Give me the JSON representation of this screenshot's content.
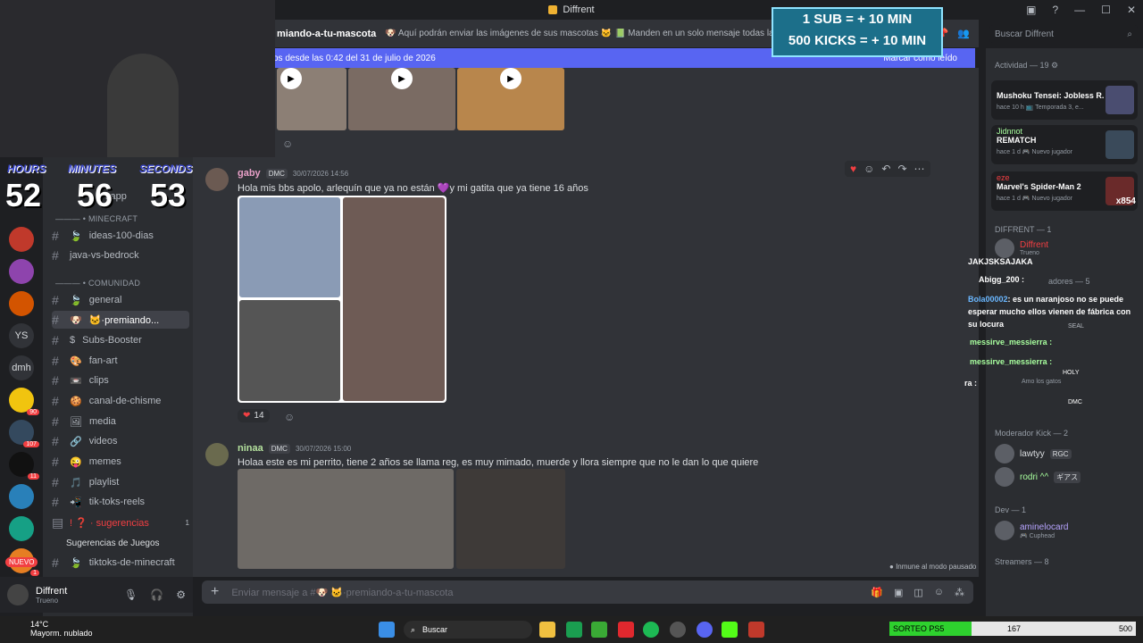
{
  "window": {
    "title": "Diffrent",
    "controls": [
      "▣",
      "?",
      "—",
      "☐",
      "✕"
    ]
  },
  "overlay": {
    "line1": "1 SUB = + 10 MIN",
    "line2": "500 KICKS = + 10 MIN"
  },
  "timer": {
    "hours_label": "HOURS",
    "minutes_label": "MINUTES",
    "seconds_label": "SECONDS",
    "hours": "52",
    "minutes": "56",
    "seconds": "53"
  },
  "servers": [
    {
      "label": "",
      "badge": ""
    },
    {
      "label": "",
      "badge": ""
    },
    {
      "label": "",
      "badge": ""
    },
    {
      "label": "YS",
      "badge": ""
    },
    {
      "label": "dmh",
      "badge": ""
    },
    {
      "label": "",
      "badge": "90"
    },
    {
      "label": "",
      "badge": "107"
    },
    {
      "label": "",
      "badge": "11"
    },
    {
      "label": "",
      "badge": ""
    },
    {
      "label": "",
      "badge": ""
    },
    {
      "label": "",
      "badge": "1"
    },
    {
      "label": "",
      "badge": ""
    }
  ],
  "nuevo_label": "NUEVO",
  "channels": {
    "partial_top": "sapp",
    "categories": [
      {
        "label": "——— • MINECRAFT"
      },
      {
        "label": "——— • COMUNIDAD"
      }
    ],
    "items": [
      {
        "label": "ideas-100-dias",
        "icon": "🍃"
      },
      {
        "label": "java-vs-bedrock",
        "icon": ""
      },
      {
        "label": "general",
        "icon": "🍃"
      },
      {
        "label": "🐱·premiando...",
        "icon": "🐶"
      },
      {
        "label": "Subs-Booster",
        "icon": "$"
      },
      {
        "label": "fan-art",
        "icon": "🎨"
      },
      {
        "label": "clips",
        "icon": "📼"
      },
      {
        "label": "canal-de-chisme",
        "icon": "🍪"
      },
      {
        "label": "media",
        "icon": "🖼"
      },
      {
        "label": "videos",
        "icon": "🔗"
      },
      {
        "label": "memes",
        "icon": "😜"
      },
      {
        "label": "playlist",
        "icon": "🎵"
      },
      {
        "label": "tik-toks-reels",
        "icon": "📲"
      },
      {
        "label": "! ❓ · sugerencias",
        "icon": ""
      },
      {
        "label": "Sugerencias de Juegos",
        "icon": ""
      },
      {
        "label": "tiktoks-de-minecraft",
        "icon": "🍃"
      }
    ],
    "sugerencias_count": "1"
  },
  "user": {
    "name": "Diffrent",
    "status": "Trueno"
  },
  "topbar": {
    "channel": "miando-a-tu-mascota",
    "topic": "🐶 Aquí podrán enviar las imágenes de sus mascotas 🐱 📗 Manden en un solo mensaje todas las fotos de s"
  },
  "banner": {
    "text": "os desde las 0:42 del 31 de julio de 2026",
    "action": "Marcar como leído"
  },
  "messages": [
    {
      "name": "gaby",
      "tag": "DMC",
      "time": "30/07/2026 14:56",
      "text": "Hola mis bbs apolo, arlequín que ya no están 💜y mi gatita que ya tiene 16 años",
      "reaction_count": "14"
    },
    {
      "name": "ninaa",
      "tag": "DMC",
      "time": "30/07/2026 15:00",
      "text": "Holaa este es mi perrito, tiene 2 años se llama reg, es muy mimado, muerde y llora siempre que no le dan lo que quiere"
    }
  ],
  "input": {
    "placeholder": "Enviar mensaje a #🐶 🐱·premiando-a-tu-mascota"
  },
  "paused_note": "Inmune al modo pausado",
  "search": {
    "placeholder": "Buscar Diffrent"
  },
  "members": {
    "activity_header": "Actividad — 19",
    "activities": [
      {
        "title": "Mushoku Tensei: Jobless R...",
        "sub": "hace 10 h  📺 Temporada 3, e..."
      },
      {
        "title": "REMATCH",
        "sub": "hace 1 d  🎮 Nuevo jugador",
        "user": "Jidnnot"
      },
      {
        "title": "Marvel's Spider-Man 2",
        "sub": "hace 1 d  🎮 Nuevo jugador",
        "user": "eze"
      }
    ],
    "sections": [
      {
        "label": "DIFFRENT — 1"
      },
      {
        "label": "Moderador Kick — 2"
      },
      {
        "label": "Dev — 1"
      },
      {
        "label": "Streamers — 8"
      }
    ],
    "list": [
      {
        "name": "Diffrent",
        "sub": "Trueno",
        "color": "#f23f42"
      },
      {
        "name": "lawtyy",
        "tag": "RGC",
        "color": "#dbdee1"
      },
      {
        "name": "rodri ^^",
        "tag": "ギアス",
        "color": "#a8ff9e"
      },
      {
        "name": "aminelocard",
        "sub": "🎮 Cuphead",
        "color": "#b7a4ff"
      }
    ],
    "partial_labels": {
      "mod": "adores — 5",
      "amo": "Amo los gatos",
      "seal": "SEAL",
      "holy": "HOLY",
      "dmc": "DMC"
    },
    "spiderman_count": "x854"
  },
  "kick_chat": [
    {
      "user": "",
      "msg": "JAKJSKSAJAKA"
    },
    {
      "user": "Abigg_200 :",
      "msg": ""
    },
    {
      "user": "Bola00002",
      "msg": ": es un naranjoso no se puede esperar mucho ellos vienen de fábrica con su locura"
    },
    {
      "user": "messirve_messierra :",
      "msg": ""
    },
    {
      "user": "messirve_messierra :",
      "msg": ""
    },
    {
      "user": "ra :",
      "msg": ""
    }
  ],
  "taskbar": {
    "temp": "14°C",
    "weather": "Mayorm. nublado",
    "search": "Buscar"
  },
  "progress": {
    "label": "SORTEO PS5",
    "value": "167",
    "max": "500",
    "fraction": 0.334
  }
}
